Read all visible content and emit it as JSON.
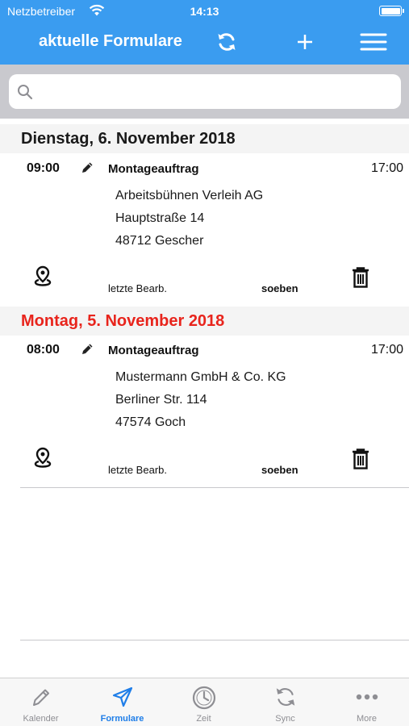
{
  "status_bar": {
    "carrier": "Netzbetreiber",
    "time": "14:13"
  },
  "header": {
    "title": "aktuelle Formulare",
    "icons": [
      "sync-icon",
      "plus-icon",
      "menu-icon"
    ]
  },
  "search": {
    "placeholder": "",
    "value": ""
  },
  "groups": [
    {
      "date": "Dienstag, 6. November 2018",
      "date_color": "#1a1a1a",
      "entry": {
        "start_time": "09:00",
        "type": "Montageauftrag",
        "end_time": "17:00",
        "address": [
          "Arbeitsbühnen Verleih AG",
          "Hauptstraße 14",
          "48712 Gescher"
        ],
        "edit_label": "letzte Bearb.",
        "edit_value": "soeben"
      }
    },
    {
      "date": "Montag, 5. November 2018",
      "date_color": "#e8241c",
      "entry": {
        "start_time": "08:00",
        "type": "Montageauftrag",
        "end_time": "17:00",
        "address": [
          "Mustermann GmbH & Co. KG",
          "Berliner Str. 114",
          "47574 Goch"
        ],
        "edit_label": "letzte Bearb.",
        "edit_value": "soeben"
      }
    }
  ],
  "tabbar": {
    "active": "Formulare",
    "tabs": [
      {
        "label": "Kalender",
        "icon": "pencil-icon"
      },
      {
        "label": "Formulare",
        "icon": "paper-plane-icon"
      },
      {
        "label": "Zeit",
        "icon": "clock-icon"
      },
      {
        "label": "Sync",
        "icon": "sync-icon"
      },
      {
        "label": "More",
        "icon": "more-dots-icon"
      }
    ]
  },
  "colors": {
    "header_bg": "#3a9cf0",
    "accent": "#1f7ee8",
    "past_date": "#e8241c",
    "inactive_tab": "#8e8e93"
  }
}
